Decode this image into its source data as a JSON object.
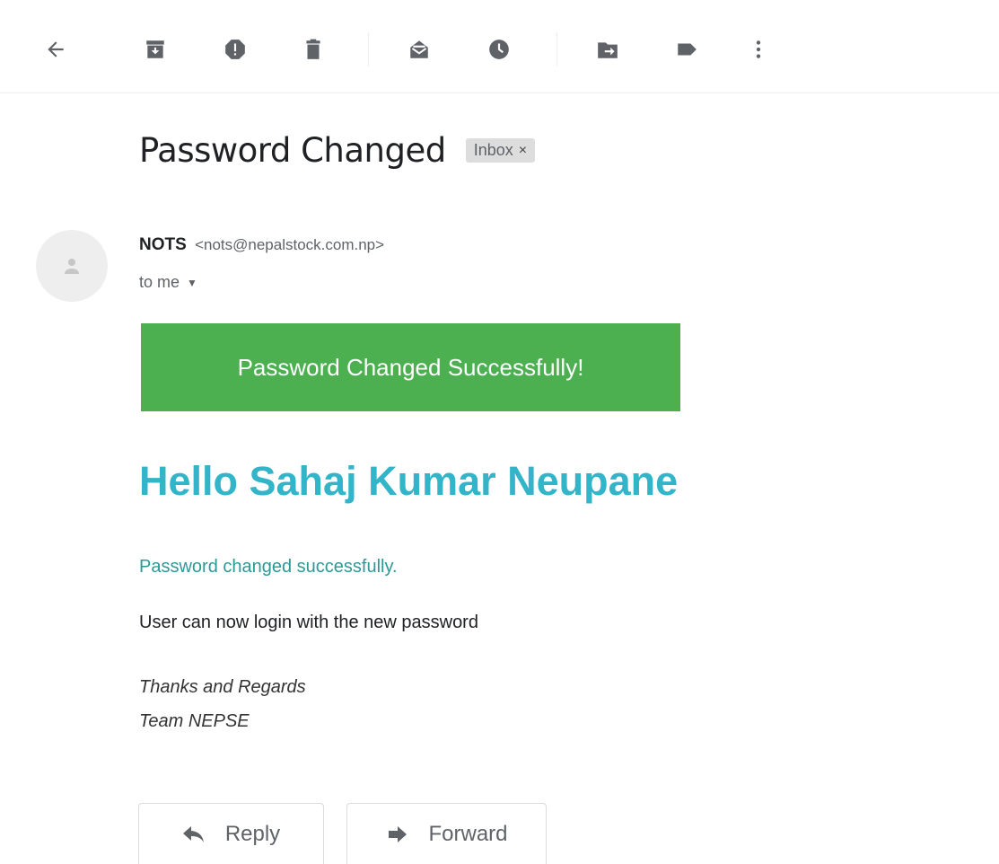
{
  "toolbar": {
    "icons": [
      "back-arrow-icon",
      "archive-icon",
      "report-spam-icon",
      "delete-icon",
      "mark-unread-icon",
      "snooze-icon",
      "move-to-icon",
      "label-icon",
      "more-vert-icon"
    ]
  },
  "message": {
    "subject": "Password Changed",
    "label_chip": "Inbox",
    "label_chip_close": "×",
    "sender_name": "NOTS",
    "sender_email": "<nots@nepalstock.com.np>",
    "recipient": "to me",
    "banner_text": "Password Changed Successfully!",
    "greeting": "Hello Sahaj Kumar Neupane",
    "status_line": "Password changed successfully.",
    "body_line": "User can now login with the new password",
    "closing": "Thanks and Regards",
    "signature": "Team NEPSE"
  },
  "actions": {
    "reply_label": "Reply",
    "forward_label": "Forward"
  },
  "colors": {
    "banner": "#4caf50",
    "greeting": "#33b5c9",
    "status_line": "#2b9a97",
    "icon": "#5f6368"
  }
}
